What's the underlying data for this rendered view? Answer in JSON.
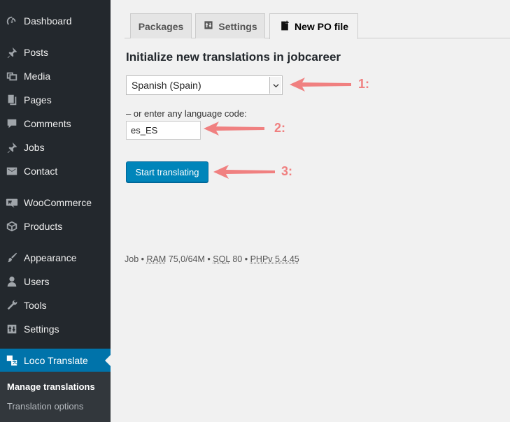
{
  "sidebar": {
    "items": [
      {
        "label": "Dashboard",
        "icon": "dashboard-icon"
      },
      {
        "label": "Posts",
        "icon": "pin-icon"
      },
      {
        "label": "Media",
        "icon": "media-icon"
      },
      {
        "label": "Pages",
        "icon": "pages-icon"
      },
      {
        "label": "Comments",
        "icon": "comment-icon"
      },
      {
        "label": "Jobs",
        "icon": "pin-icon"
      },
      {
        "label": "Contact",
        "icon": "mail-icon"
      },
      {
        "label": "WooCommerce",
        "icon": "woo-icon"
      },
      {
        "label": "Products",
        "icon": "box-icon"
      },
      {
        "label": "Appearance",
        "icon": "brush-icon"
      },
      {
        "label": "Users",
        "icon": "user-icon"
      },
      {
        "label": "Tools",
        "icon": "wrench-icon"
      },
      {
        "label": "Settings",
        "icon": "settings-icon"
      },
      {
        "label": "Loco Translate",
        "icon": "translate-icon"
      }
    ],
    "submenu": [
      {
        "label": "Manage translations"
      },
      {
        "label": "Translation options"
      }
    ]
  },
  "tabs": [
    {
      "label": "Packages"
    },
    {
      "label": "Settings"
    },
    {
      "label": "New PO file"
    }
  ],
  "main": {
    "title": "Initialize new translations in jobcareer",
    "language_select": "Spanish (Spain)",
    "code_label": "– or enter any language code:",
    "code_value": "es_ES",
    "start_button": "Start translating"
  },
  "footer": {
    "site": "Job",
    "ram_label": "RAM",
    "ram_value": "75,0/64M",
    "sql_label": "SQL",
    "sql_value": "80",
    "php_label": "PHP",
    "php_value": "v 5.4.45",
    "separator": "•"
  },
  "annotations": [
    "1:",
    "2:",
    "3:"
  ],
  "colors": {
    "sidebar_bg": "#23282d",
    "active_bg": "#0073aa",
    "button_bg": "#0085ba",
    "arrow": "#f08080"
  }
}
